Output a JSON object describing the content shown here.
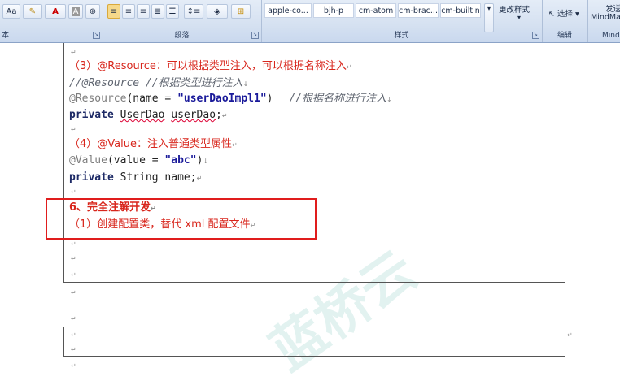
{
  "ribbon": {
    "font_size_btn": "Aa",
    "font_group_label": "本",
    "paragraph_group_label": "段落",
    "styles_group_label": "样式",
    "editing_group_label": "编辑",
    "mindmap_group_label": "Mind",
    "style_tiles": [
      "apple-co...",
      "bjh-p",
      "cm-atom",
      "cm-brac...",
      "cm-builtin"
    ],
    "change_styles_label": "更改样式",
    "select_label": "选择",
    "send_label": "发送",
    "mindmap_label": "MindMa"
  },
  "document": {
    "pilcrow": "↵",
    "resource_heading_num": "（3）",
    "resource_heading_text": "@Resource：可以根据类型注入，可以根据名称注入",
    "resource_comment_line": "//@Resource //根据类型进行注入",
    "resource_annot": "@Resource",
    "resource_param": "(name = ",
    "resource_str": "\"userDaoImpl1\"",
    "resource_close": ")",
    "resource_trail_comment": "//根据名称进行注入",
    "private_kw": "private",
    "private_type1": "UserDao",
    "private_field1": "userDao",
    "semicolon": ";",
    "value_heading_num": "（4）",
    "value_heading_text": "@Value：注入普通类型属性",
    "value_annot": "@Value",
    "value_param": "(value = ",
    "value_str": "\"abc\"",
    "value_close": ")",
    "private_type2": "String",
    "private_field2": "name",
    "section6_title": "6、完全注解开发",
    "section6_sub": "（1）创建配置类，替代 xml 配置文件"
  },
  "watermark": "蓝桥云"
}
